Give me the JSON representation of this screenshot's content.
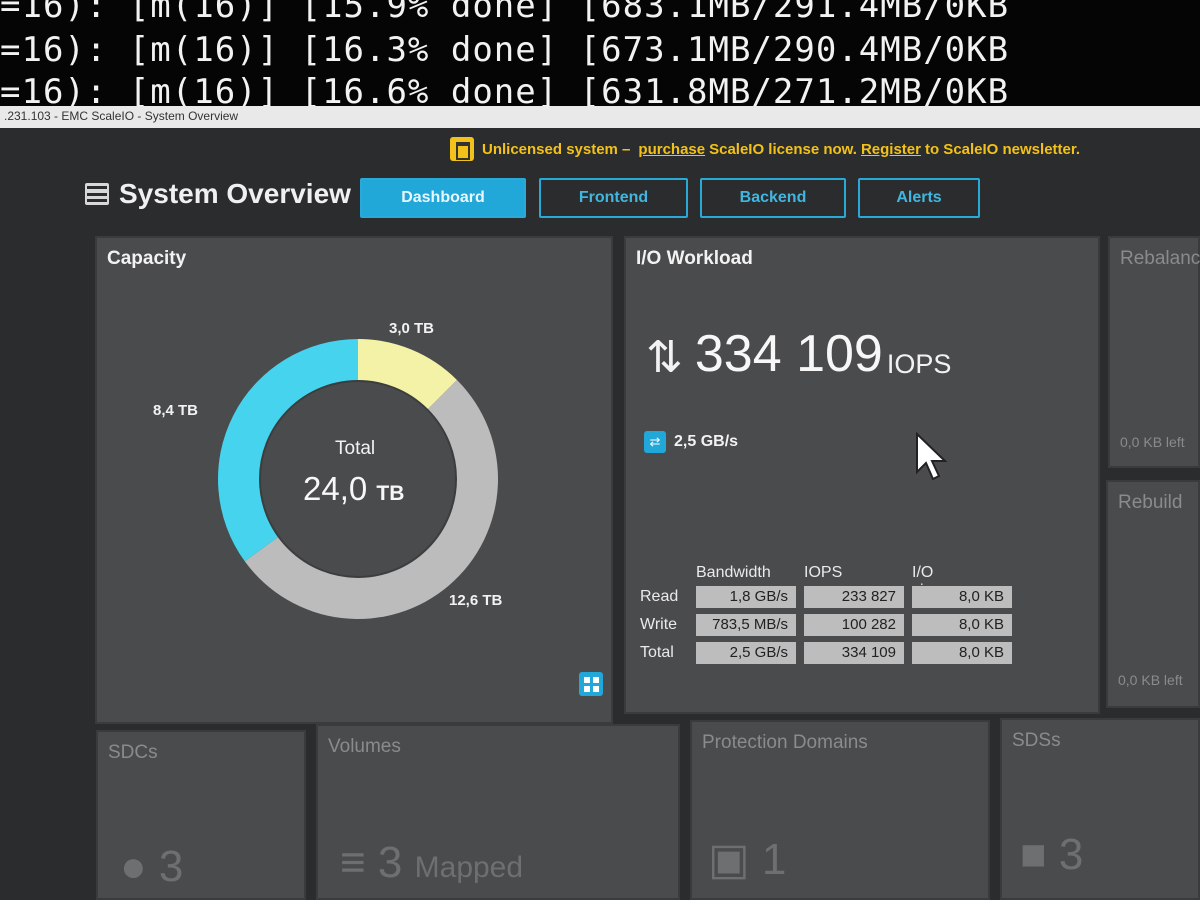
{
  "terminal": {
    "lines": [
      "=16): [m(16)] [15.9% done] [683.1MB/291.4MB/0KB",
      "=16): [m(16)] [16.3% done] [673.1MB/290.4MB/0KB",
      "=16): [m(16)] [16.6% done] [631.8MB/271.2MB/0KB"
    ]
  },
  "window": {
    "title": ".231.103 - EMC ScaleIO - System Overview"
  },
  "notice": {
    "prefix": "Unlicensed system –",
    "purchase_link": "purchase",
    "middle": "ScaleIO license now.",
    "register_link": "Register",
    "suffix": "to ScaleIO newsletter."
  },
  "header": {
    "title": "System Overview"
  },
  "tabs": [
    {
      "label": "Dashboard",
      "active": true
    },
    {
      "label": "Frontend",
      "active": false
    },
    {
      "label": "Backend",
      "active": false
    },
    {
      "label": "Alerts",
      "active": false
    }
  ],
  "capacity": {
    "title": "Capacity",
    "segments": [
      {
        "label": "3,0 TB",
        "value": 3.0,
        "color": "#f4f2a6"
      },
      {
        "label": "12,6 TB",
        "value": 12.6,
        "color": "#bcbcbc"
      },
      {
        "label": "8,4 TB",
        "value": 8.4,
        "color": "#45d3ee"
      }
    ],
    "total_label": "Total",
    "total_value": "24,0",
    "total_unit": "TB"
  },
  "io": {
    "title": "I/O Workload",
    "iops_value": "334 109",
    "iops_unit": "IOPS",
    "bandwidth": "2,5 GB/s",
    "columns": [
      "Bandwidth",
      "IOPS",
      "I/O size"
    ],
    "rows": [
      {
        "label": "Read",
        "bandwidth": "1,8 GB/s",
        "iops": "233 827",
        "size": "8,0 KB"
      },
      {
        "label": "Write",
        "bandwidth": "783,5 MB/s",
        "iops": "100 282",
        "size": "8,0 KB"
      },
      {
        "label": "Total",
        "bandwidth": "2,5 GB/s",
        "iops": "334 109",
        "size": "8,0 KB"
      }
    ]
  },
  "side": {
    "rebalance_title": "Rebalanc",
    "rebalance_value": "0,0 KB left",
    "rebuild_title": "Rebuild",
    "rebuild_value": "0,0 KB left"
  },
  "tiles": {
    "sdcs": {
      "title": "SDCs",
      "value": "3"
    },
    "volumes": {
      "title": "Volumes",
      "value": "3",
      "unit": "Mapped"
    },
    "protection": {
      "title": "Protection Domains",
      "value": "1"
    },
    "sdss": {
      "title": "SDSs",
      "value": "3"
    }
  },
  "colors": {
    "accent": "#21a8d8",
    "warning": "#f3c21a"
  }
}
